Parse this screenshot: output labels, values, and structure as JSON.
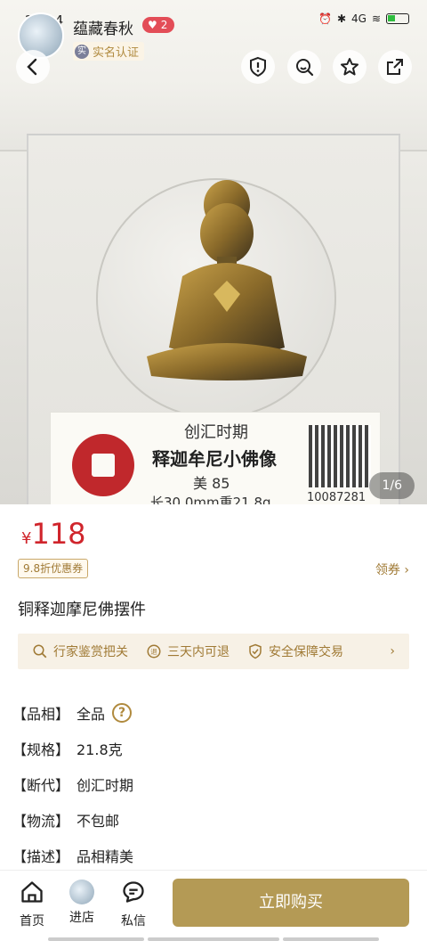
{
  "status_bar": {
    "time": "21:34",
    "network": "4G"
  },
  "shop": {
    "name": "蕴藏春秋",
    "vip_level": "2",
    "verified_label": "实名认证"
  },
  "hero": {
    "counter": "1/6",
    "label_line1": "创汇时期",
    "label_line2": "释迦牟尼小佛像",
    "label_line3": "美 85",
    "label_line4": "长30.0mm重21.8g",
    "cert_number": "10087281"
  },
  "price": {
    "currency": "¥",
    "value": "118"
  },
  "coupon": {
    "label": "9.8折优惠券",
    "claim": "领券 ›"
  },
  "product_title": "铜释迦摩尼佛摆件",
  "guarantees": [
    "行家鉴赏把关",
    "三天内可退",
    "安全保障交易"
  ],
  "attributes": [
    {
      "key": "【品相】",
      "value": "全品",
      "help": "?"
    },
    {
      "key": "【规格】",
      "value": "21.8克"
    },
    {
      "key": "【断代】",
      "value": "创汇时期"
    },
    {
      "key": "【物流】",
      "value": "不包邮"
    },
    {
      "key": "【描述】",
      "value": "品相精美"
    }
  ],
  "bottom_bar": {
    "home": "首页",
    "store": "进店",
    "message": "私信",
    "buy": "立即购买"
  },
  "colors": {
    "accent": "#b49a55",
    "price": "#d0252c",
    "gold_text": "#a07a35"
  }
}
